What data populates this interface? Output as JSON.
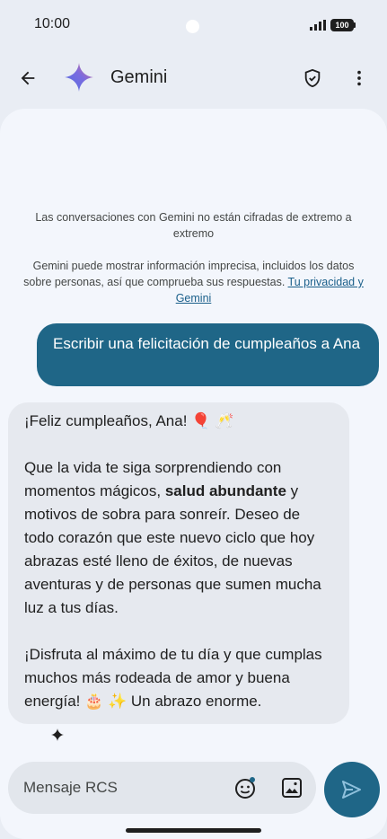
{
  "status_bar": {
    "time": "10:00",
    "battery": "100"
  },
  "app_bar": {
    "title": "Gemini"
  },
  "notices": {
    "encryption": "Las conversaciones con Gemini no están cifradas de extremo a extremo",
    "accuracy": "Gemini puede mostrar información imprecisa, incluidos los datos sobre personas, así que comprueba sus respuestas.",
    "link": "Tu privacidad y Gemini"
  },
  "messages": {
    "outgoing": "Escribir una felicitación de cumpleaños a Ana",
    "incoming": {
      "line1": "¡Feliz cumpleaños, Ana! 🎈 🥂",
      "para2_before": "Que la vida te siga sorprendiendo con momentos mágicos, ",
      "para2_bold": "salud abundante",
      "para2_after": " y motivos de sobra para sonreír. Deseo de todo corazón que este nuevo ciclo que hoy abrazas esté lleno de éxitos, de nuevas aventuras y de personas que sumen mucha luz a tus días.",
      "para3": "¡Disfruta al máximo de tu día y que cumplas muchos más rodeada de amor y buena energía! 🎂 ✨ Un abrazo enorme."
    }
  },
  "composer": {
    "placeholder": "Mensaje RCS"
  },
  "icons": {
    "back": "arrow-back-icon",
    "logo": "gemini-sparkle-icon",
    "shield": "shield-check-icon",
    "more": "more-vert-icon",
    "emoji": "emoji-icon",
    "image": "image-icon",
    "send": "send-icon"
  },
  "colors": {
    "accent": "#1f6687",
    "background": "#e9edf4",
    "panel": "#f3f6fc",
    "incoming_bubble": "#e6e9ef"
  }
}
